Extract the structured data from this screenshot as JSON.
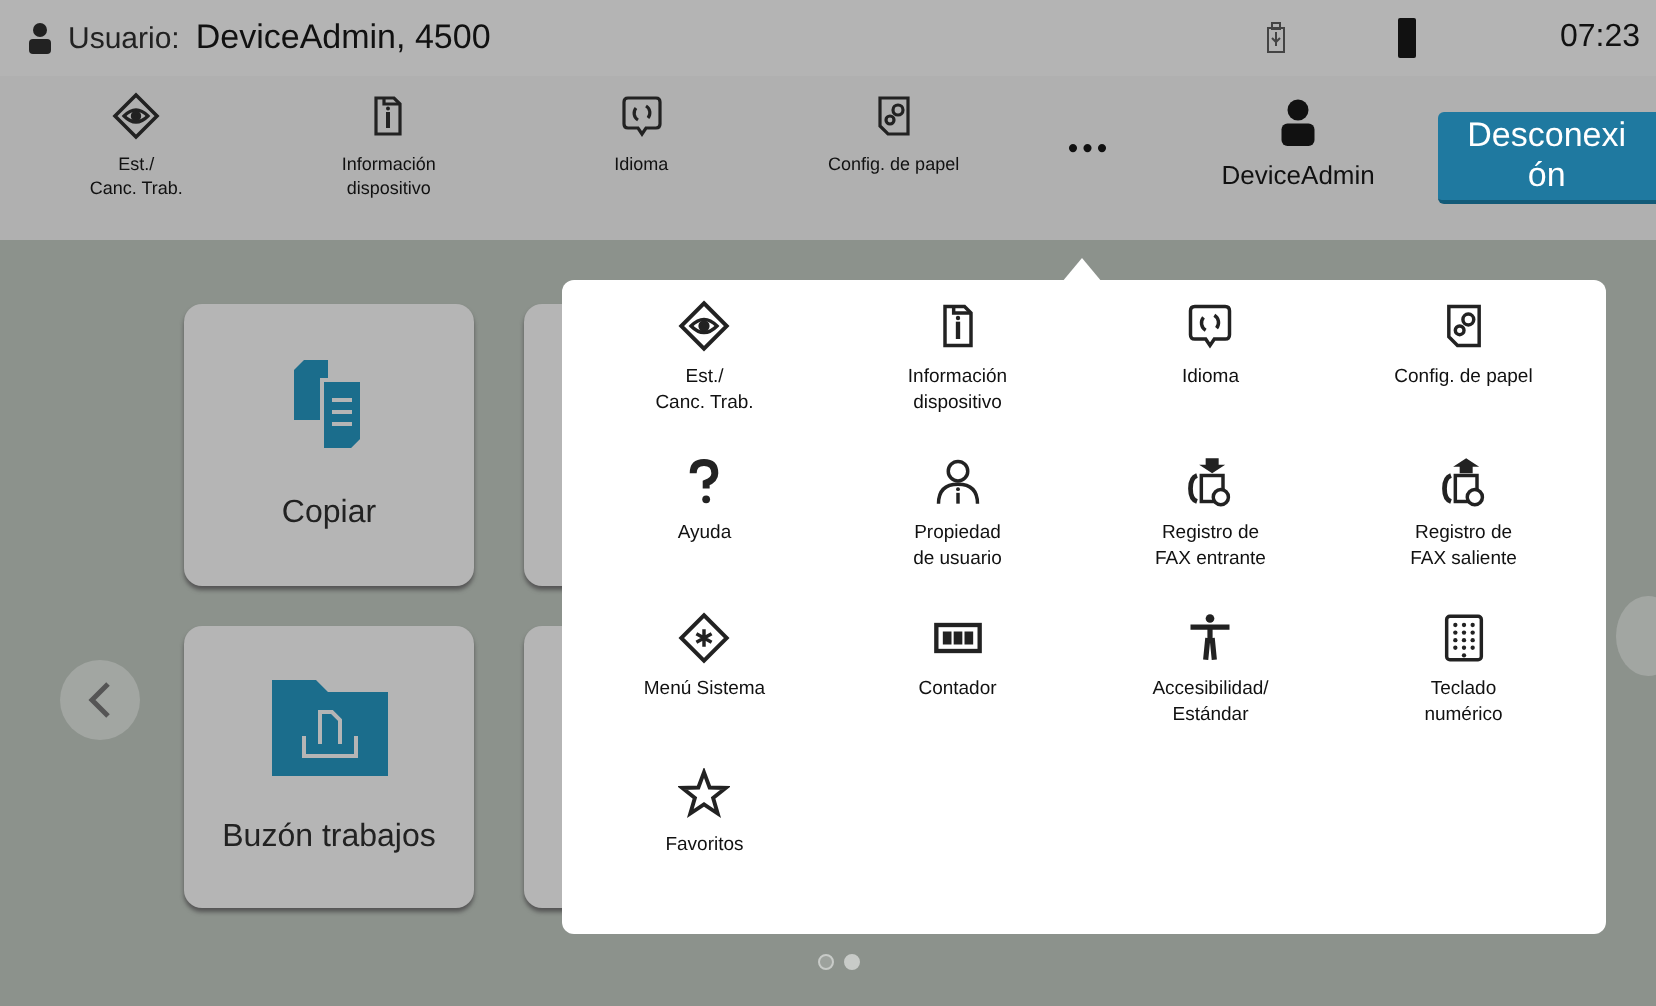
{
  "status_bar": {
    "user_label": "Usuario:",
    "user_value": "DeviceAdmin, 4500",
    "time": "07:23"
  },
  "toolbar": {
    "items": [
      {
        "label": "Est./\nCanc. Trab."
      },
      {
        "label": "Información\ndispositivo"
      },
      {
        "label": "Idioma"
      },
      {
        "label": "Config. de papel"
      }
    ],
    "more": "•••",
    "user": "DeviceAdmin",
    "logout_lines": [
      "Desconexi",
      "ón"
    ]
  },
  "tiles": [
    {
      "label": "Copiar"
    },
    {
      "label": "Buzón trabajos"
    }
  ],
  "page_dots": [
    {
      "selected": false
    },
    {
      "selected": true
    }
  ],
  "menu": {
    "items": [
      {
        "label": "Est./\nCanc. Trab."
      },
      {
        "label": "Información\ndispositivo"
      },
      {
        "label": "Idioma"
      },
      {
        "label": "Config. de papel"
      },
      {
        "label": "Ayuda"
      },
      {
        "label": "Propiedad\nde usuario"
      },
      {
        "label": "Registro de\nFAX entrante"
      },
      {
        "label": "Registro de\nFAX saliente"
      },
      {
        "label": "Menú Sistema"
      },
      {
        "label": "Contador"
      },
      {
        "label": "Accesibilidad/\nEstándar"
      },
      {
        "label": "Teclado\nnumérico"
      },
      {
        "label": "Favoritos"
      }
    ]
  }
}
